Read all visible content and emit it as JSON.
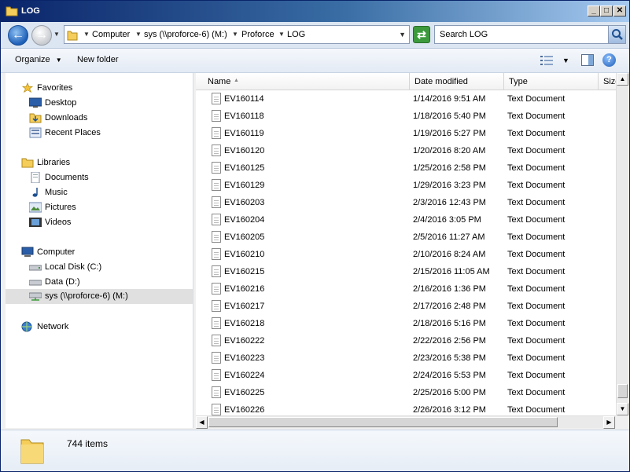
{
  "window": {
    "title": "LOG"
  },
  "window_buttons": {
    "minimize": "_",
    "maximize": "□",
    "close": "✕"
  },
  "nav": {
    "crumbs": [
      "Computer",
      "sys (\\\\proforce-6) (M:)",
      "Proforce",
      "LOG"
    ]
  },
  "search": {
    "placeholder": "Search LOG"
  },
  "toolbar": {
    "organize": "Organize",
    "new_folder": "New folder"
  },
  "sidebar": {
    "favorites": {
      "label": "Favorites",
      "items": [
        "Desktop",
        "Downloads",
        "Recent Places"
      ]
    },
    "libraries": {
      "label": "Libraries",
      "items": [
        "Documents",
        "Music",
        "Pictures",
        "Videos"
      ]
    },
    "computer": {
      "label": "Computer",
      "items": [
        "Local Disk (C:)",
        "Data (D:)",
        "sys (\\\\proforce-6) (M:)"
      ]
    },
    "network": {
      "label": "Network"
    }
  },
  "columns": {
    "name": "Name",
    "date": "Date modified",
    "type": "Type",
    "size": "Size"
  },
  "files": [
    {
      "name": "EV160114",
      "date": "1/14/2016 9:51 AM",
      "type": "Text Document"
    },
    {
      "name": "EV160118",
      "date": "1/18/2016 5:40 PM",
      "type": "Text Document"
    },
    {
      "name": "EV160119",
      "date": "1/19/2016 5:27 PM",
      "type": "Text Document"
    },
    {
      "name": "EV160120",
      "date": "1/20/2016 8:20 AM",
      "type": "Text Document"
    },
    {
      "name": "EV160125",
      "date": "1/25/2016 2:58 PM",
      "type": "Text Document"
    },
    {
      "name": "EV160129",
      "date": "1/29/2016 3:23 PM",
      "type": "Text Document"
    },
    {
      "name": "EV160203",
      "date": "2/3/2016 12:43 PM",
      "type": "Text Document"
    },
    {
      "name": "EV160204",
      "date": "2/4/2016 3:05 PM",
      "type": "Text Document"
    },
    {
      "name": "EV160205",
      "date": "2/5/2016 11:27 AM",
      "type": "Text Document"
    },
    {
      "name": "EV160210",
      "date": "2/10/2016 8:24 AM",
      "type": "Text Document"
    },
    {
      "name": "EV160215",
      "date": "2/15/2016 11:05 AM",
      "type": "Text Document"
    },
    {
      "name": "EV160216",
      "date": "2/16/2016 1:36 PM",
      "type": "Text Document"
    },
    {
      "name": "EV160217",
      "date": "2/17/2016 2:48 PM",
      "type": "Text Document"
    },
    {
      "name": "EV160218",
      "date": "2/18/2016 5:16 PM",
      "type": "Text Document"
    },
    {
      "name": "EV160222",
      "date": "2/22/2016 2:56 PM",
      "type": "Text Document"
    },
    {
      "name": "EV160223",
      "date": "2/23/2016 5:38 PM",
      "type": "Text Document"
    },
    {
      "name": "EV160224",
      "date": "2/24/2016 5:53 PM",
      "type": "Text Document"
    },
    {
      "name": "EV160225",
      "date": "2/25/2016 5:00 PM",
      "type": "Text Document"
    },
    {
      "name": "EV160226",
      "date": "2/26/2016 3:12 PM",
      "type": "Text Document"
    }
  ],
  "status": {
    "count": "744 items"
  }
}
